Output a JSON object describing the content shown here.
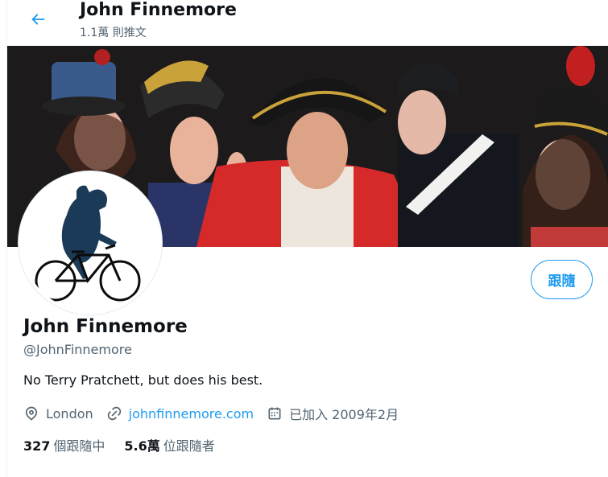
{
  "header": {
    "back_icon": "arrow-left-icon",
    "title": "John Finnemore",
    "subtitle": "1.1萬 則推文"
  },
  "profile": {
    "display_name": "John Finnemore",
    "handle": "@JohnFinnemore",
    "bio": "No Terry Pratchett, but does his best.",
    "follow_label": "跟隨",
    "location": "London",
    "website": "johnfinnemore.com",
    "joined": "已加入 2009年2月"
  },
  "stats": {
    "following_count": "327",
    "following_label": "個跟隨中",
    "followers_count": "5.6萬",
    "followers_label": "位跟隨者"
  },
  "icons": {
    "location": "location-pin-icon",
    "link": "link-icon",
    "calendar": "calendar-icon"
  },
  "colors": {
    "accent": "#1d9bf0",
    "text": "#0f1419",
    "muted": "#536471"
  }
}
